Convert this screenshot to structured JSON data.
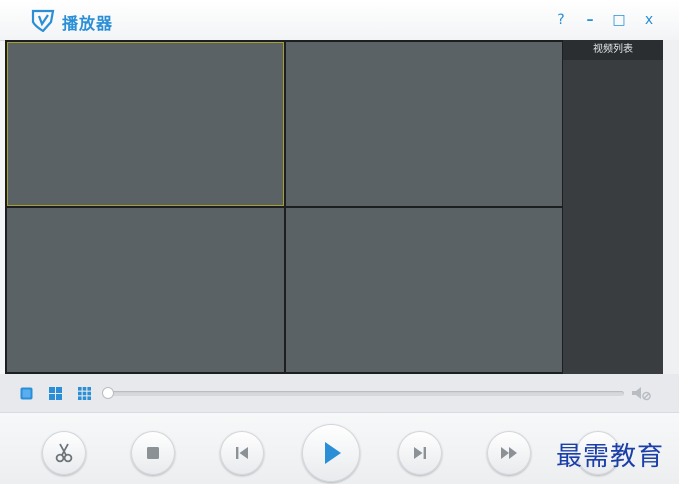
{
  "app": {
    "title": "播放器"
  },
  "window_controls": {
    "help": "?",
    "minimize": "–",
    "maximize": "□",
    "close": "x"
  },
  "sidebar": {
    "header": "视频列表"
  },
  "playback": {
    "progress": 0.0
  },
  "watermark": "最需教育",
  "colors": {
    "accent": "#2a8fd6",
    "video_bg": "#5a6266",
    "selected_border": "#a4a032",
    "sidebar_bg": "#3a3d40"
  },
  "icons": {
    "layout": [
      "layout-1x1-icon",
      "layout-2x2-icon",
      "layout-3x3-icon"
    ],
    "controls": [
      "scissors-icon",
      "stop-icon",
      "previous-icon",
      "play-icon",
      "next-icon",
      "fast-forward-icon"
    ]
  }
}
